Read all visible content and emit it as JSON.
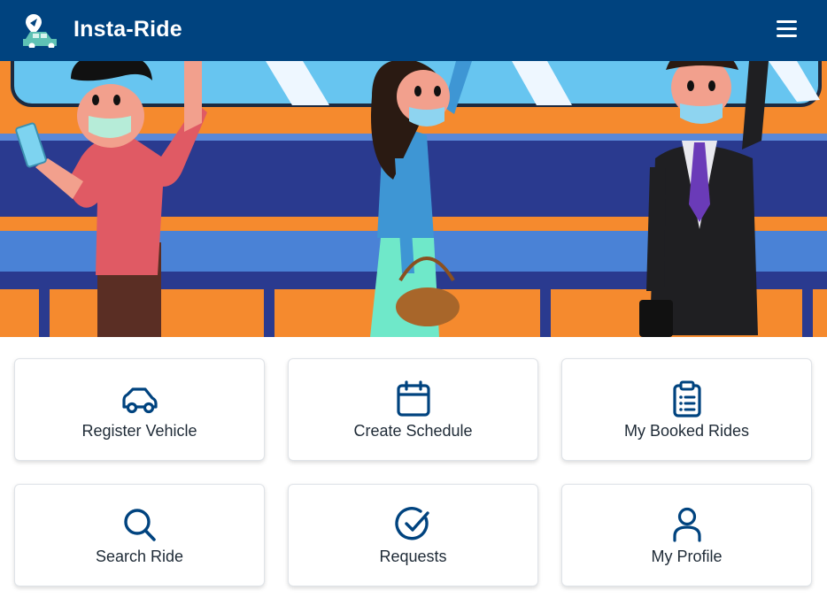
{
  "header": {
    "app_title": "Insta-Ride",
    "logo_icon": "car-with-location-pin-icon",
    "menu_icon": "hamburger-menu-icon",
    "bg_color": "#00437f"
  },
  "banner": {
    "description_icon": "commuters-on-bus-illustration"
  },
  "tiles": [
    {
      "label": "Register Vehicle",
      "icon": "car-icon"
    },
    {
      "label": "Create Schedule",
      "icon": "calendar-icon"
    },
    {
      "label": "My Booked Rides",
      "icon": "clipboard-list-icon"
    },
    {
      "label": "Search Ride",
      "icon": "search-icon"
    },
    {
      "label": "Requests",
      "icon": "check-circle-icon"
    },
    {
      "label": "My Profile",
      "icon": "user-icon"
    }
  ],
  "colors": {
    "accent": "#00437f",
    "text": "#1e2a36",
    "card_border": "#dfe3e8"
  }
}
